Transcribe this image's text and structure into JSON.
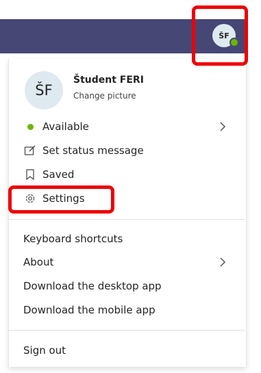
{
  "header": {
    "avatar_initials": "ŠF"
  },
  "profile": {
    "initials": "ŠF",
    "name": "Študent FERI",
    "change_picture": "Change picture"
  },
  "menu": {
    "available": "Available",
    "set_status": "Set status message",
    "saved": "Saved",
    "settings": "Settings",
    "keyboard_shortcuts": "Keyboard shortcuts",
    "about": "About",
    "download_desktop": "Download the desktop app",
    "download_mobile": "Download the mobile app",
    "sign_out": "Sign out"
  },
  "colors": {
    "header_bg": "#464775",
    "available_green": "#6bb700",
    "highlight_red": "#ee0000"
  },
  "icons": [
    "status-dot-icon",
    "edit-status-icon",
    "bookmark-icon",
    "gear-icon",
    "chevron-right-icon"
  ]
}
